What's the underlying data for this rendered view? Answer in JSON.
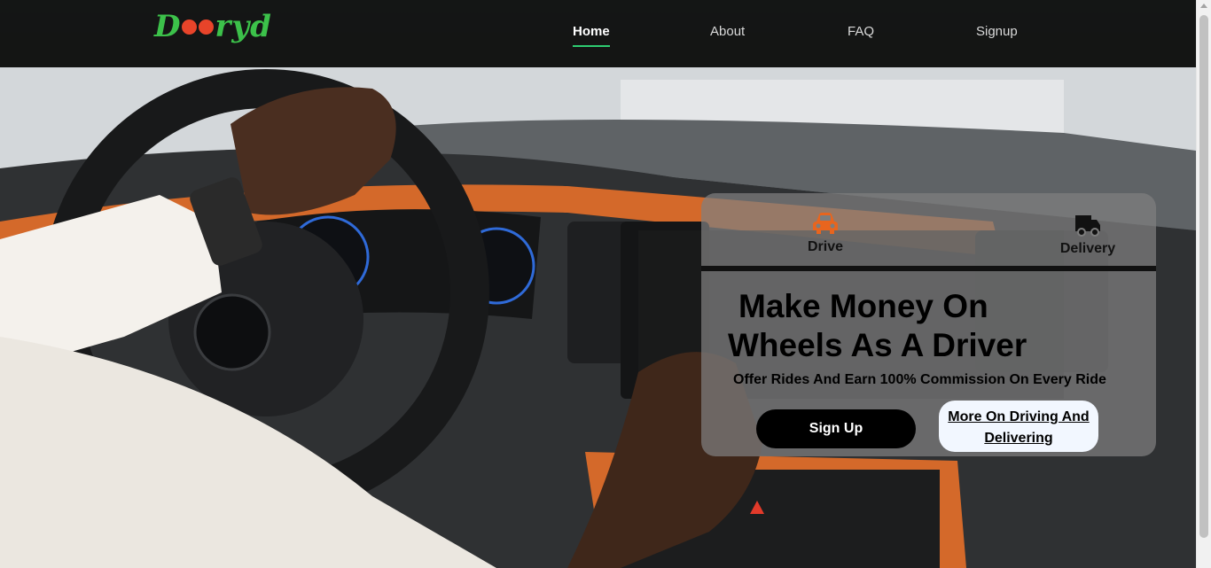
{
  "brand": {
    "logo_text_start": "D",
    "logo_text_end": "ryd"
  },
  "nav": {
    "items": [
      {
        "label": "Home",
        "active": true
      },
      {
        "label": "About",
        "active": false
      },
      {
        "label": "FAQ",
        "active": false
      },
      {
        "label": "Signup",
        "active": false
      }
    ]
  },
  "hero_card": {
    "tabs": [
      {
        "label": "Drive",
        "icon": "car-icon",
        "color": "#e8651e"
      },
      {
        "label": "Delivery",
        "icon": "truck-icon",
        "color": "#111111"
      }
    ],
    "headline_line1": "Make Money On",
    "headline_line2": "Wheels As A Driver",
    "subline": "Offer Rides And Earn 100% Commission On Every Ride",
    "signup_button": "Sign Up",
    "more_button_line1": "More On Driving And",
    "more_button_line2": "Delivering"
  },
  "colors": {
    "accent": "#2ecc71",
    "brand_green": "#3cc14a",
    "nav_bg": "#0c0e0c",
    "card_bg": "#808080",
    "orange_trim": "#d4692a"
  }
}
